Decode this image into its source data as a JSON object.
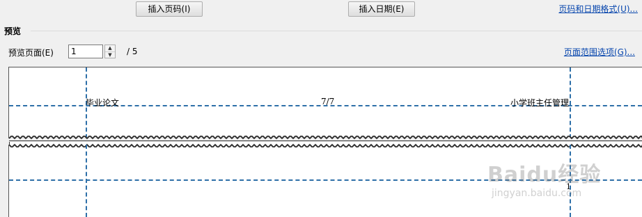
{
  "toolbar": {
    "insert_page_number": "插入页码(I)",
    "insert_date": "插入日期(E)",
    "page_date_format": "页码和日期格式(U)..."
  },
  "preview": {
    "section_title": "预览",
    "page_label": "预览页面(E)",
    "page_value": "1",
    "page_total": "/ 5",
    "page_range_link": "页面范围选项(G)..."
  },
  "pages": {
    "page1_header_left": "毕业论文",
    "page1_header_center": "7/7",
    "page1_header_right": "小学班主任管理",
    "page2_marker": "1"
  },
  "watermark": {
    "logo_text": "Baidu经验",
    "url": "jingyan.baidu.com"
  },
  "colors": {
    "guide_line": "#2d6fa8",
    "link": "#0645ad"
  }
}
